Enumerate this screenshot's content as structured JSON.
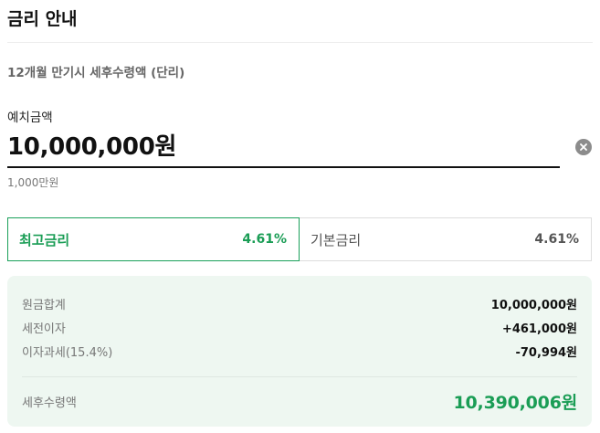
{
  "header": {
    "title": "금리 안내"
  },
  "subtitle": "12개월 만기시 세후수령액 (단리)",
  "deposit": {
    "label": "예치금액",
    "value": "10,000,000원",
    "hint": "1,000만원",
    "clear_icon": "clear-circle-icon"
  },
  "rate_tabs": [
    {
      "label": "최고금리",
      "value": "4.61%",
      "selected": true
    },
    {
      "label": "기본금리",
      "value": "4.61%",
      "selected": false
    }
  ],
  "summary": {
    "rows": [
      {
        "label": "원금합계",
        "value": "10,000,000원"
      },
      {
        "label": "세전이자",
        "value": "+461,000원"
      },
      {
        "label": "이자과세(15.4%)",
        "value": "-70,994원"
      }
    ],
    "total": {
      "label": "세후수령액",
      "value": "10,390,006원"
    }
  },
  "colors": {
    "accent": "#1a9d55",
    "summary_bg": "#eef7f1",
    "border": "#dddddd"
  }
}
